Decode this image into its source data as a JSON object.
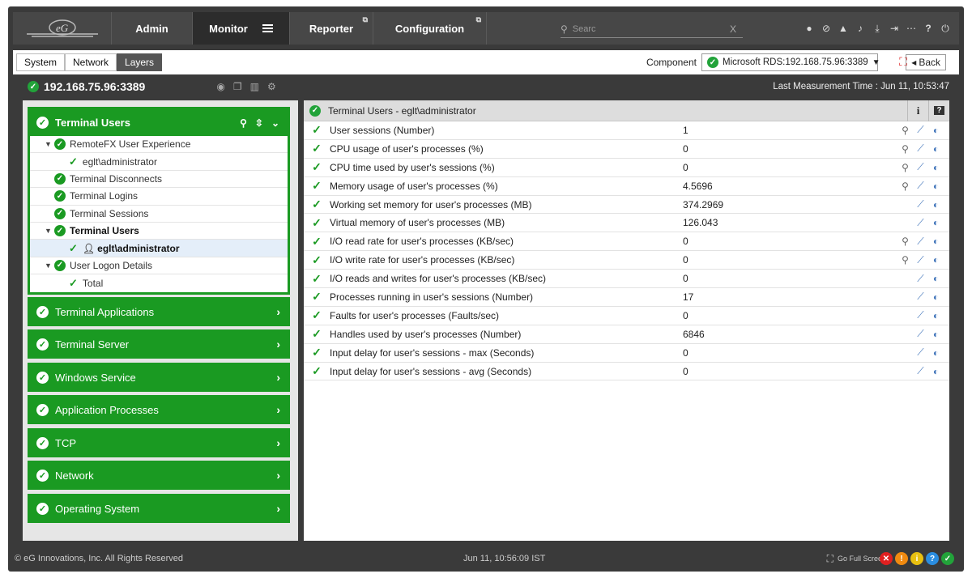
{
  "nav": {
    "admin": "Admin",
    "monitor": "Monitor",
    "reporter": "Reporter",
    "configuration": "Configuration",
    "search_placeholder": "Searc",
    "search_clear": "X"
  },
  "subnav": {
    "tabs": [
      "System",
      "Network",
      "Layers"
    ],
    "component_label": "Component",
    "component_value": "Microsoft RDS:192.168.75.96:3389",
    "back": "Back"
  },
  "header": {
    "ip": "192.168.75.96:3389",
    "last_measurement": "Last Measurement Time : Jun 11, 10:53:47"
  },
  "tree": {
    "title": "Terminal Users",
    "items": [
      "RemoteFX User Experience",
      "eglt\\administrator",
      "Terminal Disconnects",
      "Terminal Logins",
      "Terminal Sessions",
      "Terminal Users",
      "eglt\\administrator",
      "User Logon Details",
      "Total"
    ]
  },
  "groups": [
    "Terminal Applications",
    "Terminal Server",
    "Windows Service",
    "Application Processes",
    "TCP",
    "Network",
    "Operating System"
  ],
  "panel": {
    "title": "Terminal Users - eglt\\administrator",
    "info": "i",
    "help": "?"
  },
  "metrics": [
    {
      "name": "User sessions (Number)",
      "value": "1"
    },
    {
      "name": "CPU usage of user's processes (%)",
      "value": "0"
    },
    {
      "name": "CPU time used by user's sessions (%)",
      "value": "0"
    },
    {
      "name": "Memory usage of user's processes (%)",
      "value": "4.5696"
    },
    {
      "name": "Working set memory for user's processes (MB)",
      "value": "374.2969"
    },
    {
      "name": "Virtual memory of user's processes (MB)",
      "value": "126.043"
    },
    {
      "name": "I/O read rate for user's processes (KB/sec)",
      "value": "0"
    },
    {
      "name": "I/O write rate for user's processes (KB/sec)",
      "value": "0"
    },
    {
      "name": "I/O reads and writes for user's processes (KB/sec)",
      "value": "0"
    },
    {
      "name": "Processes running in user's sessions (Number)",
      "value": "17"
    },
    {
      "name": "Faults for user's processes (Faults/sec)",
      "value": "0"
    },
    {
      "name": "Handles used by user's processes (Number)",
      "value": "6846"
    },
    {
      "name": "Input delay for user's sessions - max (Seconds)",
      "value": "0"
    },
    {
      "name": "Input delay for user's sessions - avg (Seconds)",
      "value": "0"
    }
  ],
  "footer": {
    "copyright": "© eG Innovations, Inc. All Rights Reserved",
    "datetime": "Jun 11, 10:56:09 IST",
    "fullscreen": "Go Full Screen"
  },
  "colors": {
    "green": "#1a9a22",
    "dark": "#3a3a3a",
    "bar": "#474747"
  }
}
